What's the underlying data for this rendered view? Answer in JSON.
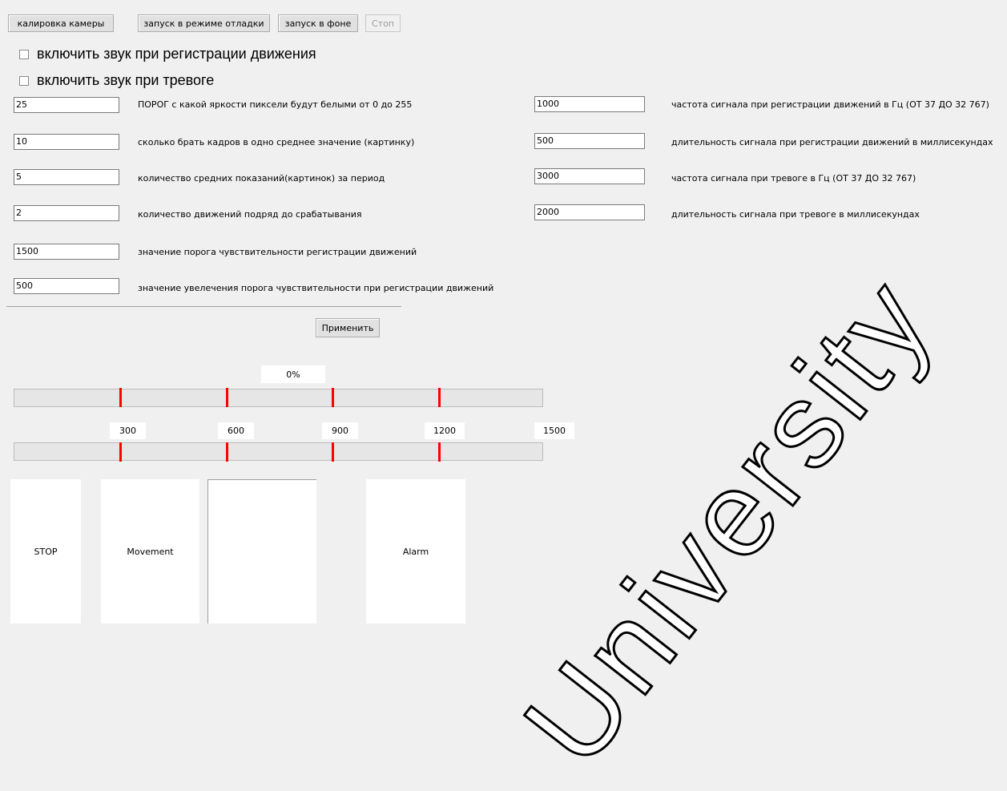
{
  "toolbar": {
    "calibrate": "калировка камеры",
    "debug_run": "запуск в режиме отладки",
    "bg_run": "запуск в фоне",
    "stop": "Стоп"
  },
  "checkboxes": {
    "sound_motion": "включить звук при регистрации движения",
    "sound_alarm": "включить звук при тревоге"
  },
  "left_fields": [
    {
      "value": "25",
      "label": "ПОРОГ с какой яркости пиксели будут белыми от 0 до 255"
    },
    {
      "value": "10",
      "label": "сколько брать кадров в одно среднее значение (картинку)"
    },
    {
      "value": "5",
      "label": "количество средних показаний(картинок) за период"
    },
    {
      "value": "2",
      "label": "количество движений подряд до срабатывания"
    },
    {
      "value": "1500",
      "label": "значение порога чувствительности регистрации движений"
    },
    {
      "value": "500",
      "label": "значение увелечения порога чувствительности при регистрации движений"
    }
  ],
  "right_fields": [
    {
      "value": "1000",
      "label": "частота сигнала при регистрации движений в Гц (ОТ 37 ДО 32 767)"
    },
    {
      "value": "500",
      "label": "длительность сигнала при регистрации движений в миллисекундах"
    },
    {
      "value": "3000",
      "label": "частота сигнала при тревоге в Гц (ОТ 37 ДО 32 767)"
    },
    {
      "value": "2000",
      "label": "длительность сигнала при тревоге в миллисекундах"
    }
  ],
  "apply": "Применить",
  "progress": {
    "percent_label": "0%",
    "value": 0
  },
  "scale_labels": [
    "300",
    "600",
    "900",
    "1200",
    "1500"
  ],
  "panels": {
    "stop": "STOP",
    "movement": "Movement",
    "alarm": "Alarm"
  },
  "colors": {
    "tick": "#ff0000",
    "background": "#f0f0f0"
  },
  "watermark": "University"
}
